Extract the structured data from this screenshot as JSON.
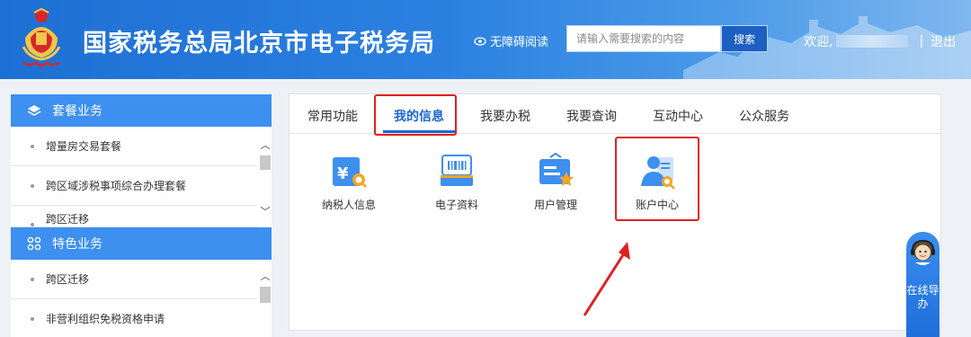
{
  "header": {
    "title": "国家税务总局北京市电子税务局",
    "accessibility_label": "无障碍阅读",
    "search": {
      "placeholder": "请输入需要搜索的内容",
      "button_label": "搜索"
    },
    "welcome_label": "欢迎,",
    "logout_label": "退出",
    "emblem_icon": "tax-emblem-icon"
  },
  "sidebar": {
    "sections": [
      {
        "title": "套餐业务",
        "icon": "layers-icon",
        "items": [
          "增量房交易套餐",
          "跨区域涉税事项综合办理套餐",
          "跨区迁移"
        ]
      },
      {
        "title": "特色业务",
        "icon": "grid-icon",
        "items": [
          "跨区迁移",
          "非营利组织免税资格申请"
        ]
      }
    ]
  },
  "main": {
    "tabs": [
      "常用功能",
      "我的信息",
      "我要办税",
      "我要查询",
      "互动中心",
      "公众服务"
    ],
    "active_tab": "我的信息",
    "functions": [
      {
        "label": "纳税人信息",
        "icon": "taxpayer-info-icon"
      },
      {
        "label": "电子资料",
        "icon": "electronic-documents-icon"
      },
      {
        "label": "用户管理",
        "icon": "user-management-icon"
      },
      {
        "label": "账户中心",
        "icon": "account-center-icon"
      }
    ]
  },
  "guide": {
    "label": "在线导办"
  },
  "colors": {
    "header_blue": "#2b80e0",
    "panel_blue": "#3d8ff0",
    "active_blue": "#1a66d1",
    "highlight_red": "#e02020"
  }
}
